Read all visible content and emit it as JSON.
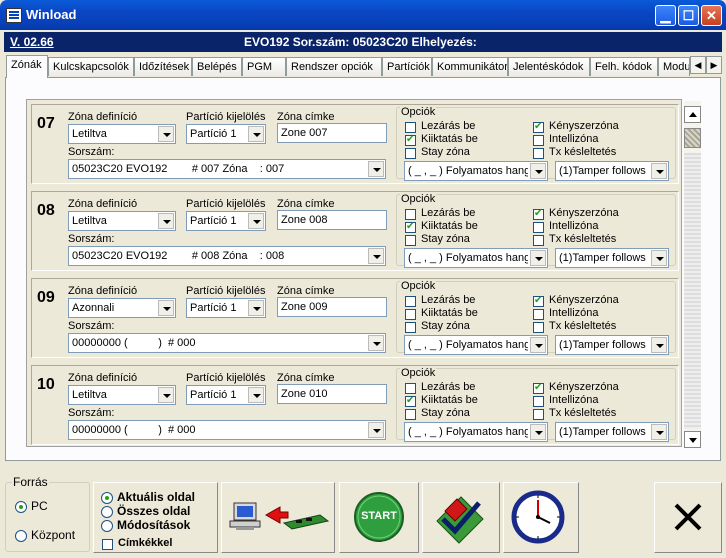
{
  "window": {
    "title": "Winload"
  },
  "header": {
    "version": "V. 02.66",
    "info": "EVO192  Sor.szám: 05023C20 Elhelyezés:"
  },
  "tabs": [
    {
      "label": "Zónák"
    },
    {
      "label": "Kulcskapcsolók"
    },
    {
      "label": "Időzítések"
    },
    {
      "label": "Belépés"
    },
    {
      "label": "PGM"
    },
    {
      "label": "Rendszer opciók"
    },
    {
      "label": "Partíciók"
    },
    {
      "label": "Kommunikátor"
    },
    {
      "label": "Jelentéskódok"
    },
    {
      "label": "Felh. kódok"
    },
    {
      "label": "Modu"
    }
  ],
  "labels": {
    "zone_def": "Zóna definíció",
    "partition": "Partíció kijelölés",
    "zone_label": "Zóna címke",
    "serial": "Sorszám:",
    "options": "Opciók",
    "opt_lock": "Lezárás be",
    "opt_bypass": "Kiiktatás be",
    "opt_stay": "Stay zóna",
    "opt_force": "Kényszerzóna",
    "opt_intelli": "Intellizóna",
    "opt_tx": "Tx késleltetés"
  },
  "zones": [
    {
      "num": "07",
      "definition": "Letiltva",
      "partition": "Partíció 1",
      "label": "Zone 007",
      "serial": "05023C20 EVO192        # 007 Zóna    : 007",
      "alarm": "( _ , _ ) Folyamatos hang",
      "tamper": "(1)Tamper follows",
      "lock": false,
      "bypass": true,
      "stay": false,
      "force": true,
      "intelli": false,
      "tx": false
    },
    {
      "num": "08",
      "definition": "Letiltva",
      "partition": "Partíció 1",
      "label": "Zone 008",
      "serial": "05023C20 EVO192        # 008 Zóna    : 008",
      "alarm": "( _ , _ ) Folyamatos hang",
      "tamper": "(1)Tamper follows",
      "lock": false,
      "bypass": true,
      "stay": false,
      "force": true,
      "intelli": false,
      "tx": false
    },
    {
      "num": "09",
      "definition": "Azonnali",
      "partition": "Partíció 1",
      "label": "Zone 009",
      "serial": "00000000 (          )  # 000",
      "alarm": "( _ , _ ) Folyamatos hang",
      "tamper": "(1)Tamper follows",
      "lock": false,
      "bypass": false,
      "stay": false,
      "force": true,
      "intelli": false,
      "tx": false
    },
    {
      "num": "10",
      "definition": "Letiltva",
      "partition": "Partíció 1",
      "label": "Zone 010",
      "serial": "00000000 (          )  # 000",
      "alarm": "( _ , _ ) Folyamatos hang",
      "tamper": "(1)Tamper follows",
      "lock": false,
      "bypass": true,
      "stay": false,
      "force": true,
      "intelli": false,
      "tx": false
    }
  ],
  "bottom": {
    "source_title": "Forrás",
    "source_pc": "PC",
    "source_central": "Központ",
    "source_selected": "PC",
    "page_current": "Aktuális oldal",
    "page_all": "Összes oldal",
    "page_changes": "Módosítások",
    "page_selected": "Aktuális oldal",
    "with_labels": "Címkékkel",
    "with_labels_checked": false,
    "start_label": "START"
  },
  "colors": {
    "titlebar": "#0a46c4",
    "header": "#0a246a",
    "start": "#2e9e3e"
  }
}
